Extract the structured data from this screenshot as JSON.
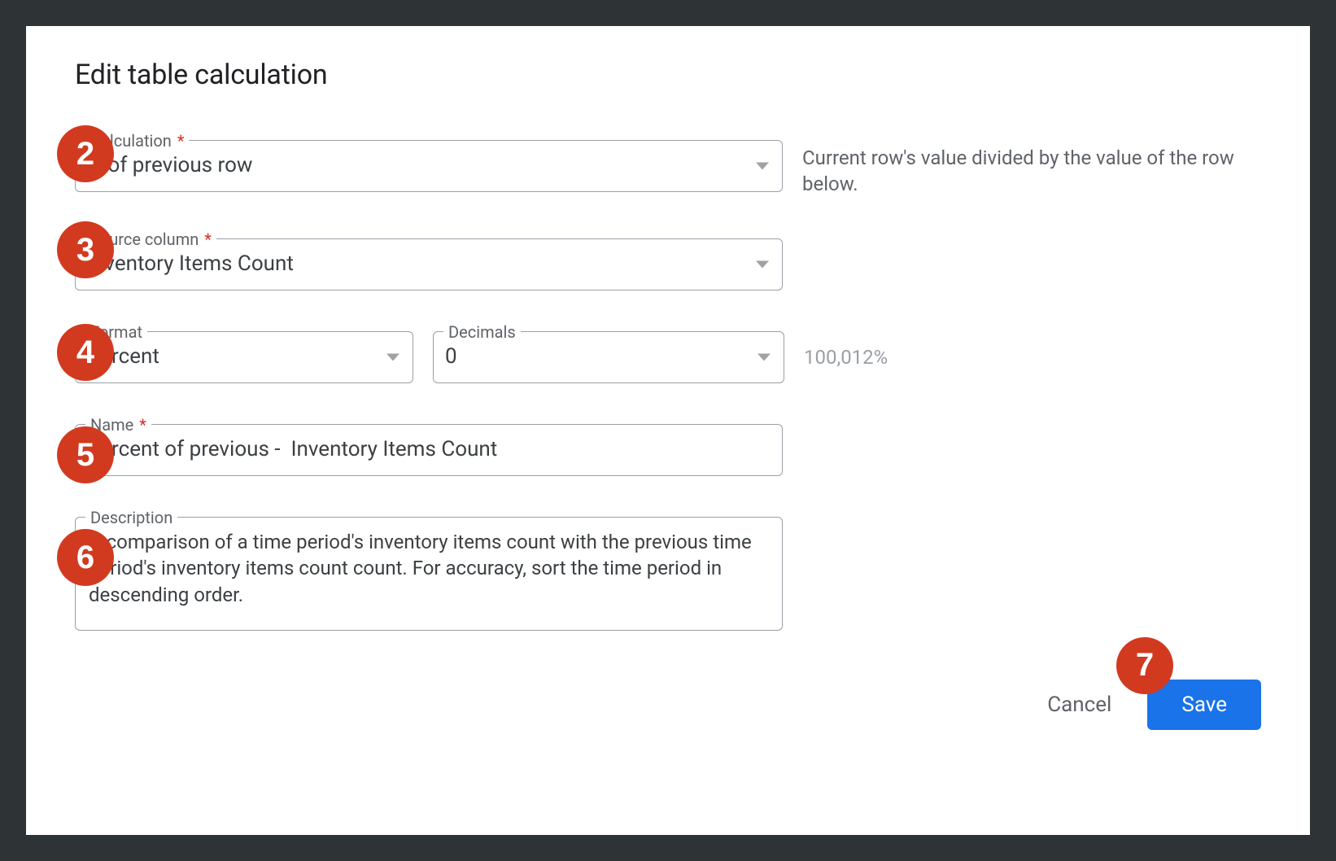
{
  "dialog": {
    "title": "Edit table calculation"
  },
  "fields": {
    "calculation": {
      "label": "Calculation",
      "value": "% of previous row",
      "helper": "Current row's value divided by the value of the row below."
    },
    "source_column": {
      "label": "Source column",
      "value": "Inventory Items Count"
    },
    "format": {
      "label": "Format",
      "value": "Percent"
    },
    "decimals": {
      "label": "Decimals",
      "value": "0",
      "example": "100,012%"
    },
    "name": {
      "label": "Name",
      "value": "Percent of previous -  Inventory Items Count"
    },
    "description": {
      "label": "Description",
      "value": "A comparison of a time period's inventory items count with the previous time period's inventory items count count. For accuracy, sort the time period in descending order."
    }
  },
  "actions": {
    "cancel": "Cancel",
    "save": "Save"
  },
  "annotations": {
    "b2": "2",
    "b3": "3",
    "b4": "4",
    "b5": "5",
    "b6": "6",
    "b7": "7"
  }
}
